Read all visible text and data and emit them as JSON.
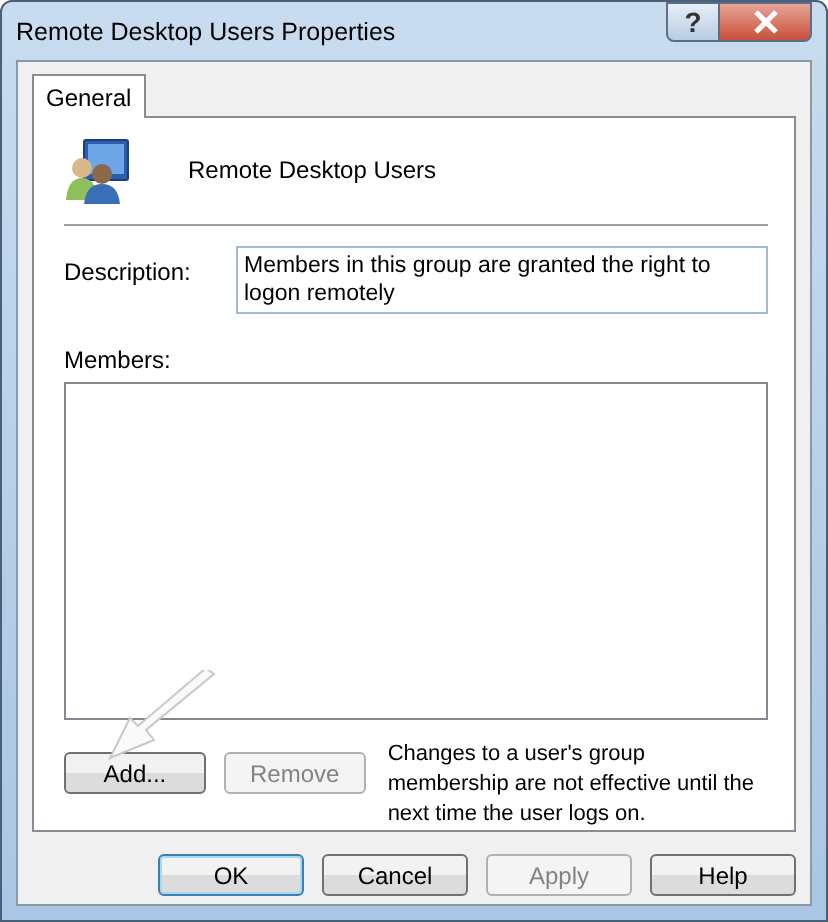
{
  "window": {
    "title": "Remote Desktop Users Properties",
    "help_glyph": "?"
  },
  "tabs": [
    {
      "label": "General",
      "selected": true
    }
  ],
  "group_name": "Remote Desktop Users",
  "description": {
    "label": "Description:",
    "value": "Members in this group are granted the right to logon remotely"
  },
  "members": {
    "label": "Members:"
  },
  "member_buttons": [
    {
      "label": "Add...",
      "disabled": false
    },
    {
      "label": "Remove",
      "disabled": true
    }
  ],
  "note": "Changes to a user's group membership are not effective until the next time the user logs on.",
  "footer_buttons": [
    {
      "label": "OK",
      "disabled": false,
      "default": true
    },
    {
      "label": "Cancel",
      "disabled": false,
      "default": false
    },
    {
      "label": "Apply",
      "disabled": true,
      "default": false
    },
    {
      "label": "Help",
      "disabled": false,
      "default": false
    }
  ]
}
